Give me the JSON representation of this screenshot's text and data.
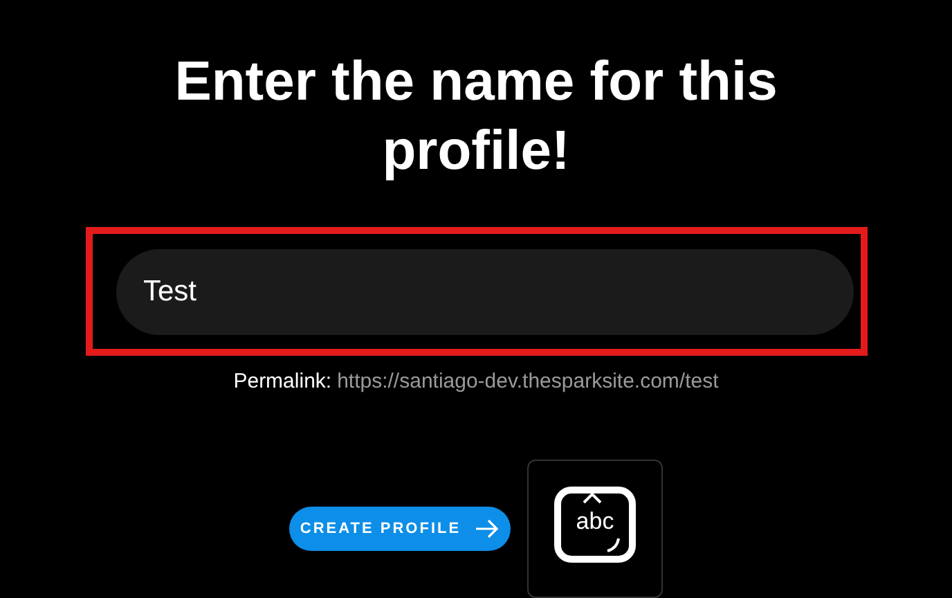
{
  "heading": "Enter the name for this profile!",
  "name_field": {
    "value": "Test",
    "highlighted": true
  },
  "permalink": {
    "label": "Permalink:",
    "url": "https://santiago-dev.thesparksite.com/test"
  },
  "create_button": {
    "label": "CREATE PROFILE"
  },
  "keyboard_overlay": {
    "label": "abc"
  }
}
